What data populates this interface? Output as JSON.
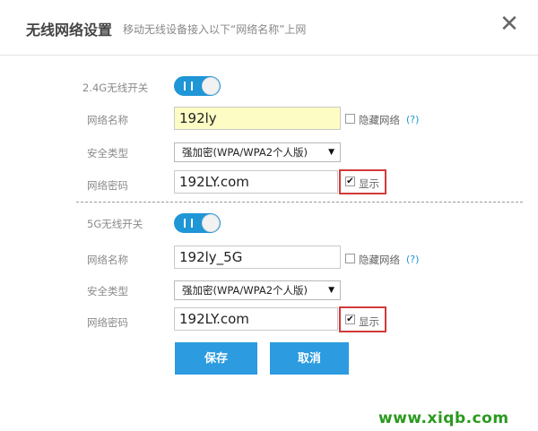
{
  "header": {
    "title": "无线网络设置",
    "subtitle": "移动无线设备接入以下“网络名称”上网",
    "close_icon": "close-icon",
    "close_glyph": "✕"
  },
  "wifi_24": {
    "switch_label": "2.4G无线开关",
    "switch_on": true,
    "ssid_label": "网络名称",
    "ssid_value": "192ly",
    "hide_label": "隐藏网络",
    "hide_checked": false,
    "help_text": "(?)",
    "security_label": "安全类型",
    "security_value": "强加密(WPA/WPA2个人版)",
    "password_label": "网络密码",
    "password_value": "192LY.com",
    "show_label": "显示",
    "show_checked": true
  },
  "wifi_5": {
    "switch_label": "5G无线开关",
    "switch_on": true,
    "ssid_label": "网络名称",
    "ssid_value": "192ly_5G",
    "hide_label": "隐藏网络",
    "hide_checked": false,
    "help_text": "(?)",
    "security_label": "安全类型",
    "security_value": "强加密(WPA/WPA2个人版)",
    "password_label": "网络密码",
    "password_value": "192LY.com",
    "show_label": "显示",
    "show_checked": true
  },
  "actions": {
    "save_label": "保存",
    "cancel_label": "取消"
  },
  "glyphs": {
    "check": "✔",
    "dropdown_arrow": "▼"
  },
  "watermark": "www.xiqb.com",
  "colors": {
    "accent": "#1f96d6",
    "button": "#2c9be0",
    "highlight_box": "#d23a3a",
    "ssid_autofill_bg": "#fcfcc4",
    "watermark": "#2a9a1f"
  }
}
